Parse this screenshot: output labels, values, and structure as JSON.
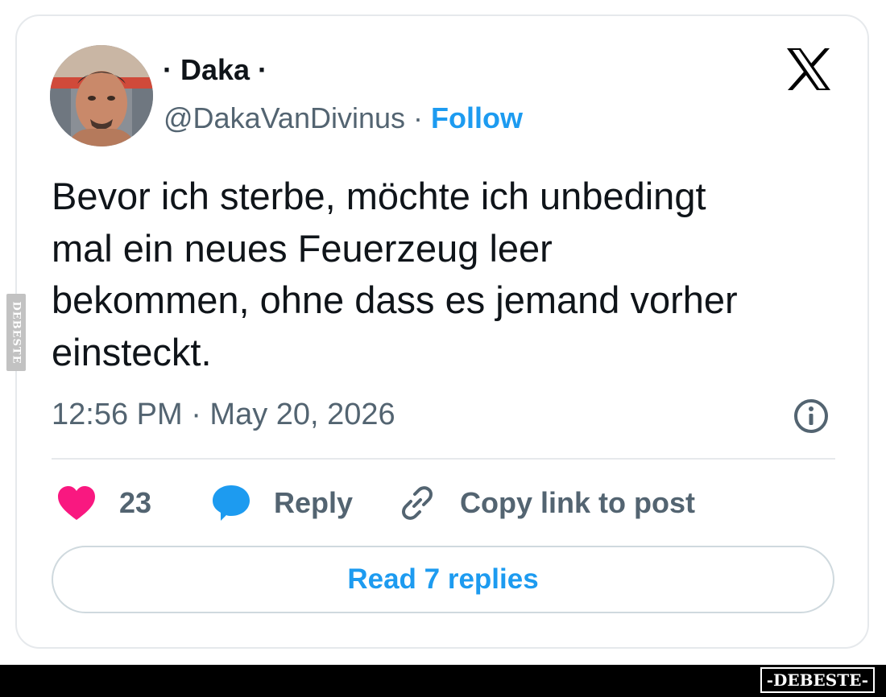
{
  "tweet": {
    "display_name": "· Daka ·",
    "handle": "@DakaVanDivinus",
    "separator": " · ",
    "follow_label": "Follow",
    "text_lines": [
      "Bevor ich sterbe, möchte ich unbedingt",
      "mal ein neues Feuerzeug leer",
      "bekommen, ohne dass es jemand vorher",
      "einsteckt."
    ],
    "timestamp": "12:56 PM · May 20, 2026"
  },
  "actions": {
    "like_count": "23",
    "reply_label": "Reply",
    "copy_link_label": "Copy link to post"
  },
  "read_replies_label": "Read 7 replies",
  "icons": {
    "brand": "x-logo-icon",
    "info": "info-icon",
    "like": "heart-icon",
    "reply": "speech-bubble-icon",
    "copy": "link-icon"
  },
  "watermark": {
    "side": "DEBESTE",
    "footer": "-DEBESTE-"
  },
  "colors": {
    "accent": "#1d9bf0",
    "heart": "#f91880",
    "text": "#0f1419",
    "secondary": "#536471",
    "border": "#e6e9ec"
  }
}
